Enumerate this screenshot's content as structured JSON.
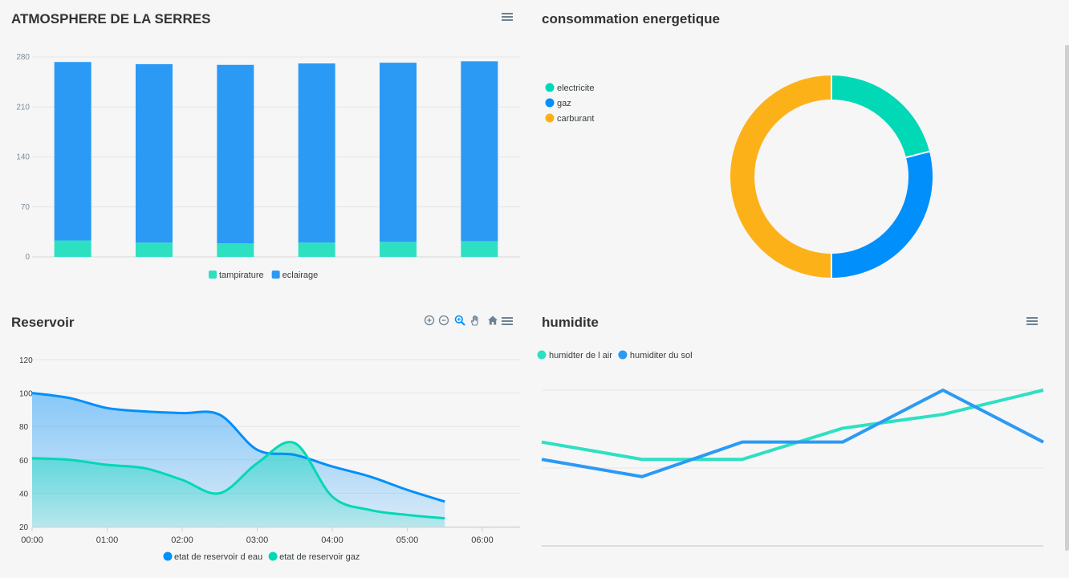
{
  "panels": {
    "atmosphere": {
      "title": "ATMOSPHERE DE LA SERRES"
    },
    "energy": {
      "title": "consommation energetique"
    },
    "reservoir": {
      "title": "Reservoir"
    },
    "humidity": {
      "title": "humidite"
    }
  },
  "icons": {
    "menu": "hamburger-menu-icon",
    "zoom_in": "zoom-in-icon",
    "zoom_out": "zoom-out-icon",
    "selection_zoom": "magnifier-icon",
    "pan": "hand-pan-icon",
    "reset": "home-icon"
  },
  "colors": {
    "teal": "#2ee0c2",
    "blue": "#2b9af5",
    "yellow": "#fdb119",
    "green": "#00d8b6",
    "midblue": "#008ffb"
  },
  "chart_data": [
    {
      "type": "bar",
      "stacked": true,
      "categories": [
        "",
        "",
        "",
        "",
        "",
        ""
      ],
      "series": [
        {
          "name": "tampirature",
          "color": "#2ee0c2",
          "values": [
            23,
            20,
            19,
            20,
            21,
            22
          ]
        },
        {
          "name": "eclairage",
          "color": "#2b9af5",
          "values": [
            250,
            250,
            250,
            251,
            251,
            252
          ]
        }
      ],
      "y_ticks": [
        "280",
        "210",
        "140",
        "70",
        "0"
      ],
      "ylim": [
        0,
        280
      ],
      "grid": true,
      "legend": "bottom"
    },
    {
      "type": "pie",
      "donut": true,
      "labels": [
        "electricite",
        "gaz",
        "carburant"
      ],
      "values": [
        21,
        29,
        50
      ],
      "colors": [
        "#00d8b6",
        "#008ffb",
        "#fdb119"
      ],
      "legend": "top-left"
    },
    {
      "type": "area",
      "x": [
        0,
        0.5,
        1,
        1.5,
        2,
        2.5,
        3,
        3.5,
        4,
        4.5,
        5,
        5.5
      ],
      "x_ticks": [
        "00:00",
        "01:00",
        "02:00",
        "03:00",
        "04:00",
        "05:00",
        "06:00"
      ],
      "series": [
        {
          "name": "etat de reservoir d eau",
          "color": "#008ffb",
          "values": [
            100,
            97,
            91,
            89,
            88,
            87,
            66,
            63,
            56,
            50,
            42,
            35
          ]
        },
        {
          "name": "etat de reservoir gaz",
          "color": "#00d8b6",
          "values": [
            61,
            60,
            57,
            55,
            48,
            40,
            58,
            70,
            38,
            30,
            27,
            25
          ]
        }
      ],
      "y_ticks": [
        "120",
        "100",
        "80",
        "60",
        "40",
        "20"
      ],
      "ylim": [
        20,
        120
      ],
      "grid": true,
      "legend": "bottom"
    },
    {
      "type": "line",
      "series": [
        {
          "name": "humidter de l air",
          "color": "#2ee0c2",
          "values": [
            60,
            50,
            50,
            68,
            76,
            90
          ]
        },
        {
          "name": "humiditer du sol",
          "color": "#2b9af5",
          "values": [
            50,
            40,
            60,
            60,
            90,
            60
          ]
        }
      ],
      "ylim": [
        0,
        90
      ],
      "grid": true,
      "legend": "top-left"
    }
  ]
}
